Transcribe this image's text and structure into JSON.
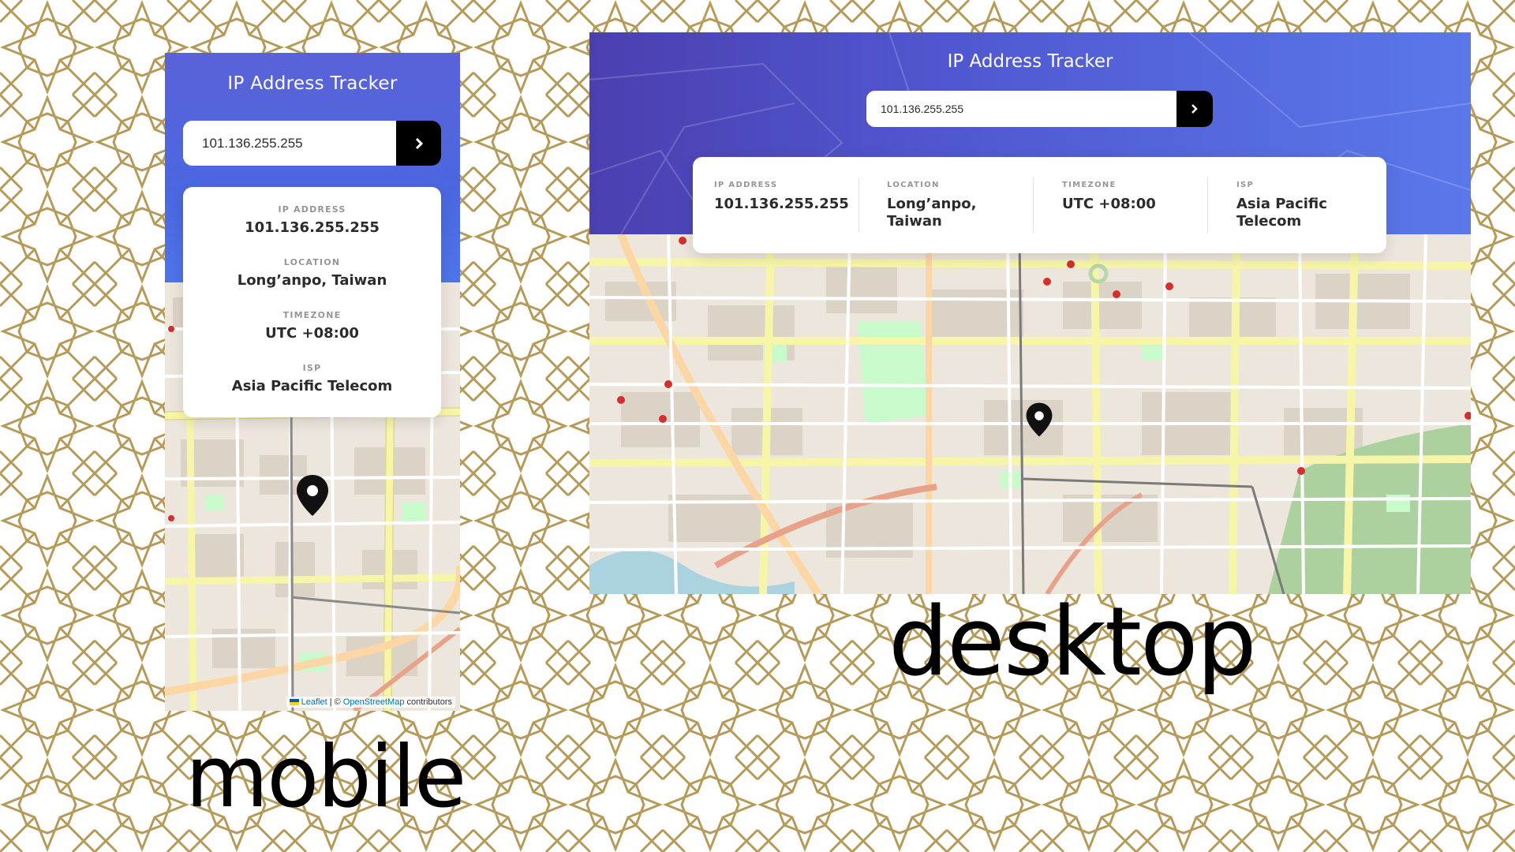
{
  "mobile": {
    "title": "IP Address Tracker",
    "search_value": "101.136.255.255",
    "info": [
      {
        "label": "IP ADDRESS",
        "value": "101.136.255.255"
      },
      {
        "label": "LOCATION",
        "value": "Long’anpo, Taiwan"
      },
      {
        "label": "TIMEZONE",
        "value": "UTC +08:00"
      },
      {
        "label": "ISP",
        "value": "Asia Pacific Telecom"
      }
    ],
    "attribution": {
      "leaflet": "Leaflet",
      "separator": "| ©",
      "osm": "OpenStreetMap",
      "contributors": "contributors"
    }
  },
  "desktop": {
    "title": "IP Address Tracker",
    "search_value": "101.136.255.255",
    "info": [
      {
        "label": "IP ADDRESS",
        "value": "101.136.255.255"
      },
      {
        "label": "LOCATION",
        "value": "Long’anpo, Taiwan"
      },
      {
        "label": "TIMEZONE",
        "value": "UTC +08:00"
      },
      {
        "label": "ISP",
        "value": "Asia Pacific Telecom"
      }
    ]
  },
  "captions": {
    "desktop": "desktop",
    "mobile": "mobile"
  },
  "colors": {
    "header_start": "#4b3fb0",
    "header_end": "#5a78ea",
    "button": "#000000",
    "pattern": "#b69a5a",
    "map_bg": "#f2efe9"
  },
  "icons": {
    "search_button": "chevron-right-icon",
    "map_marker": "location-pin-icon",
    "leaflet_flag": "ukraine-flag-icon"
  }
}
